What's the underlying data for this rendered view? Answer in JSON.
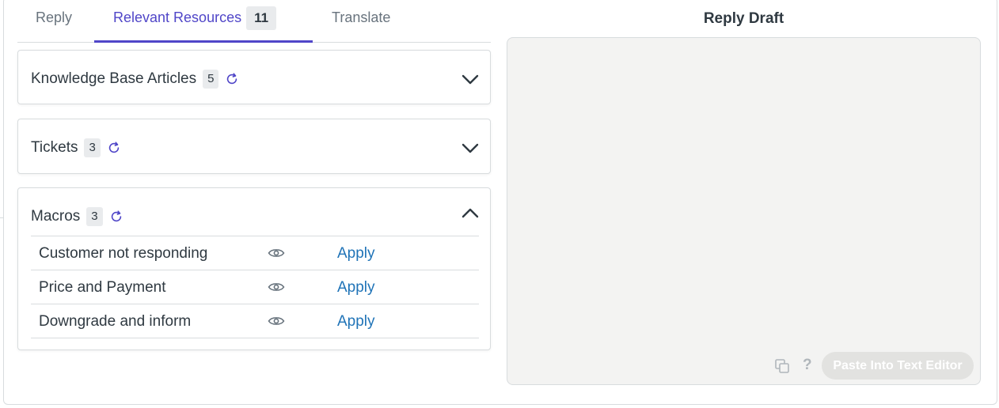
{
  "tabs": {
    "reply": "Reply",
    "relevant_resources": "Relevant Resources",
    "relevant_resources_count": "11",
    "translate": "Translate"
  },
  "sections": {
    "knowledge_base": {
      "title": "Knowledge Base Articles",
      "count": "5",
      "expanded": false
    },
    "tickets": {
      "title": "Tickets",
      "count": "3",
      "expanded": false
    },
    "macros": {
      "title": "Macros",
      "count": "3",
      "expanded": true,
      "items": [
        {
          "name": "Customer not responding",
          "action": "Apply"
        },
        {
          "name": "Price and Payment",
          "action": "Apply"
        },
        {
          "name": "Downgrade and inform",
          "action": "Apply"
        }
      ]
    }
  },
  "draft": {
    "title": "Reply Draft",
    "help": "?",
    "paste_label": "Paste Into Text Editor"
  },
  "colors": {
    "accent": "#5046c8",
    "link": "#1f73b7",
    "draft_bg": "#f3f3f2"
  },
  "icons": [
    "refresh-icon",
    "chevron-down-icon",
    "chevron-up-icon",
    "eye-icon",
    "copy-icon",
    "help-icon"
  ]
}
